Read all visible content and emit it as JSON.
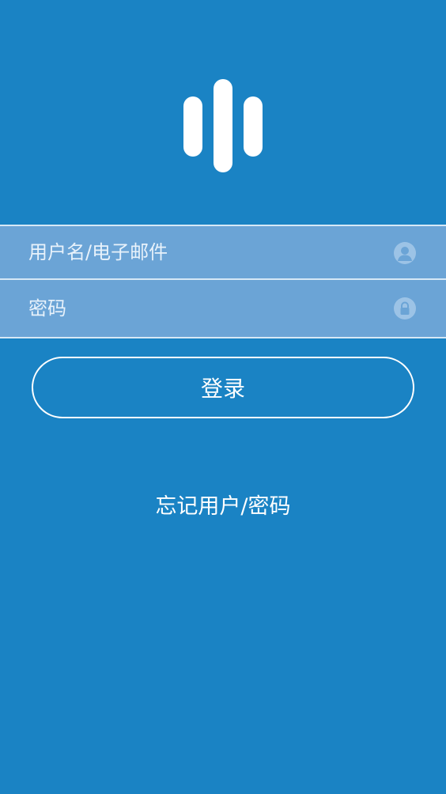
{
  "login_form": {
    "username_placeholder": "用户名/电子邮件",
    "password_placeholder": "密码",
    "login_label": "登录",
    "forgot_label": "忘记用户/密码"
  },
  "icons": {
    "username_field_icon": "user-icon",
    "password_field_icon": "lock-icon",
    "logo": "sound-bars-logo"
  },
  "colors": {
    "background": "#1a83c4",
    "field_background": "#6ba4d6",
    "text": "#ffffff"
  }
}
